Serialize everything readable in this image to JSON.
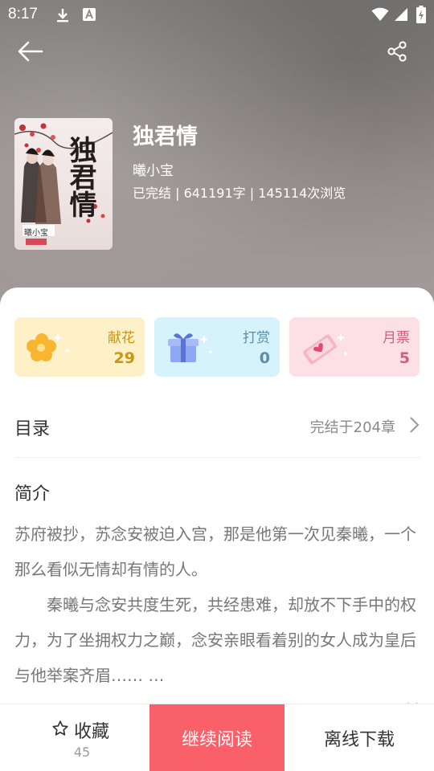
{
  "status_bar": {
    "time": "8:17",
    "icons": [
      "download-icon",
      "a-badge-icon",
      "wifi-icon",
      "signal-icon",
      "battery-charging-icon"
    ]
  },
  "header": {
    "back_icon": "back-arrow-icon",
    "share_icon": "share-icon"
  },
  "book": {
    "cover": {
      "title_text": "独君情",
      "author_text": "曦小宝",
      "icon": "book-cover-image"
    },
    "title": "独君情",
    "author": "曦小宝",
    "stats": "已完结 | 641191字 | 145114次浏览"
  },
  "gifts": [
    {
      "label": "献花",
      "count": "29",
      "icon": "flower-icon",
      "bg": "#fff1c7",
      "color": "#c99515"
    },
    {
      "label": "打赏",
      "count": "0",
      "icon": "gift-box-icon",
      "bg": "#d6f2fb",
      "color": "#5c8fa7"
    },
    {
      "label": "月票",
      "count": "5",
      "icon": "ticket-icon",
      "bg": "#fde0e6",
      "color": "#d1607a"
    }
  ],
  "toc": {
    "label": "目录",
    "status": "完结于204章"
  },
  "intro": {
    "heading": "简介",
    "paragraph1": "苏府被抄，苏念安被迫入宫，那是他第一次见秦曦，一个那么看似无情却有情的人。",
    "paragraph2": "　　秦曦与念安共度生死，共经患难，却放不下手中的权力，为了坐拥权力之巅，念安亲眼看着别的女人成为皇后与他举案齐眉…… …"
  },
  "bottom_bar": {
    "favorite_label": "收藏",
    "favorite_count": "45",
    "read_label": "继续阅读",
    "download_label": "离线下载"
  },
  "colors": {
    "accent": "#f9606a",
    "hero": "#8f8a89"
  }
}
